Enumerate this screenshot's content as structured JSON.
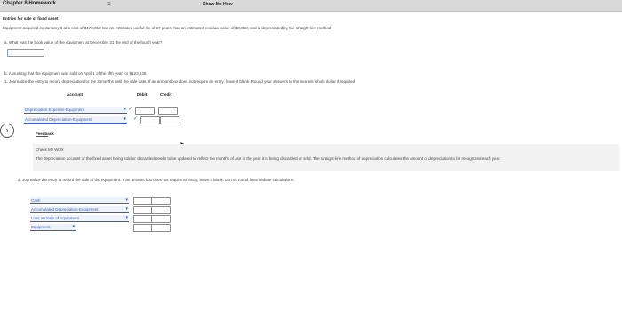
{
  "header": {
    "app_title": "Chapter 8 Homework",
    "menu_icon": "menu-icon",
    "show_me_how": "Show Me How"
  },
  "question": {
    "heading": "Entries for sale of fixed asset",
    "intro": "Equipment acquired on January 8 at a cost of $170,010 has an estimated useful life of 17 years, has an estimated residual value of $8,850, and is depreciated by the straight-line method.",
    "part_a": "a. What was the book value of the equipment at December 31 the end of the fourth year?",
    "part_a_value": "",
    "part_b": "b. Assuming that the equipment was sold on April 1 of the fifth year for $123,245.",
    "step1": "1. Journalize the entry to record depreciation for the 3 months until the sale date. If an amount box does not require an entry, leave it blank. Round your answers to the nearest whole dollar if required.",
    "col_account": "Account",
    "col_debit": "Debit",
    "col_credit": "Credit",
    "entry1_rows": [
      {
        "account": "Depreciation Expense-Equipment",
        "debit": "",
        "credit": ""
      },
      {
        "account": "Accumulated Depreciation-Equipment",
        "debit": "",
        "credit": ""
      }
    ],
    "check_mark": "✓",
    "feedback_title": "Feedback",
    "feedback_sub": "Check My Work",
    "feedback_text": "The depreciation account of the fixed asset being sold or discarded needs to be updated to reflect the months of use in the year it is being discarded or sold. The straight-line method of depreciation calculates the amount of depreciation to be recognized each year.",
    "step2": "2. Journalize the entry to record the sale of the equipment. If an amount box does not require an entry, leave it blank. Do not round intermediate calculations.",
    "entry2_rows": [
      {
        "account": "Cash",
        "debit": "",
        "credit": ""
      },
      {
        "account": "Accumulated Depreciation-Equipment",
        "debit": "",
        "credit": ""
      },
      {
        "account": "Loss on Sale of Equipment",
        "debit": "",
        "credit": ""
      },
      {
        "account": "Equipment",
        "debit": "",
        "credit": ""
      }
    ]
  }
}
